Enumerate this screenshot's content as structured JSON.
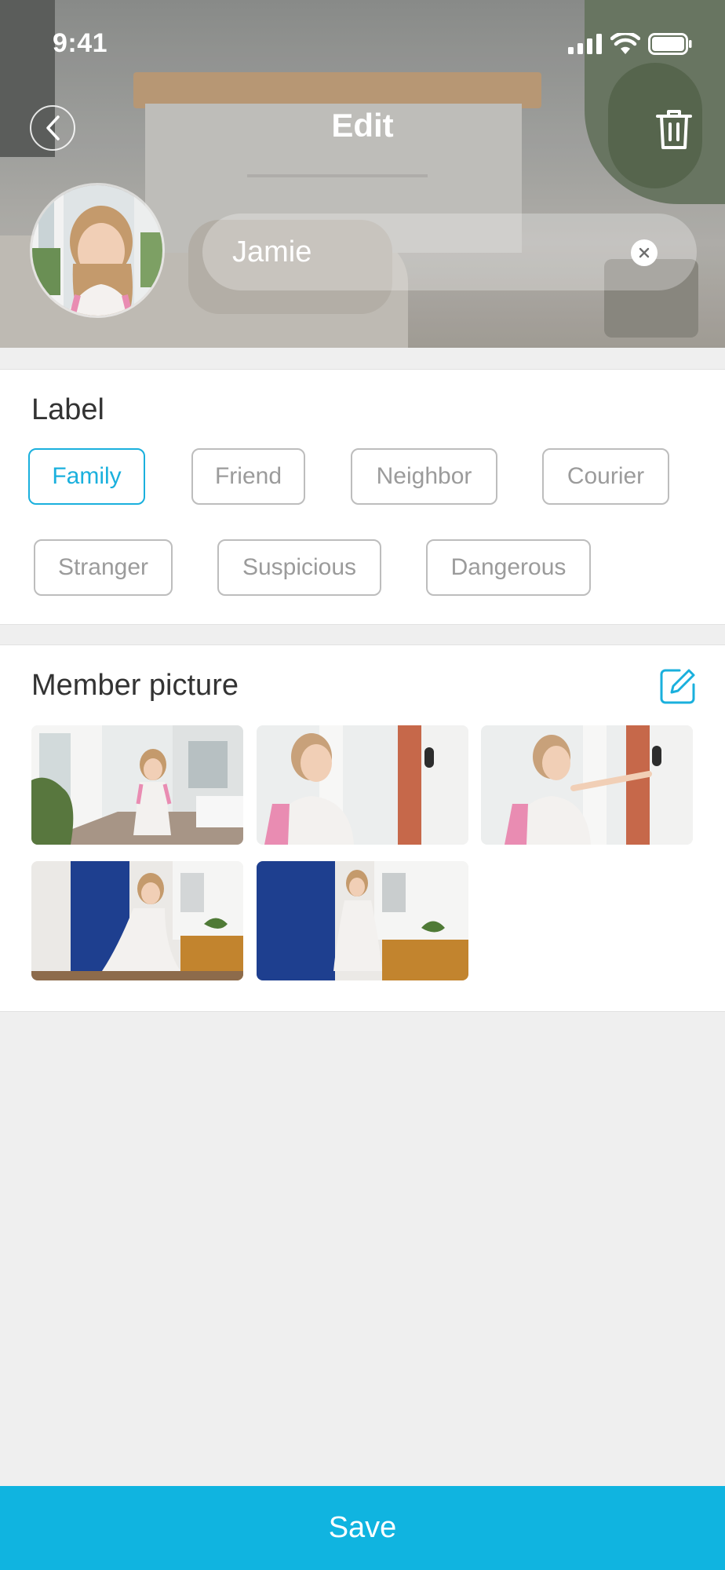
{
  "status_bar": {
    "time": "9:41"
  },
  "header": {
    "title": "Edit",
    "name_value": "Jamie"
  },
  "label_section": {
    "title": "Label",
    "selected": "Family",
    "chips": [
      "Family",
      "Friend",
      "Neighbor",
      "Courier",
      "Stranger",
      "Suspicious",
      "Dangerous"
    ]
  },
  "picture_section": {
    "title": "Member picture",
    "picture_count": 5
  },
  "footer": {
    "save_label": "Save"
  },
  "colors": {
    "accent": "#1ab0dd",
    "save_bar": "#10b4e0",
    "chip_border": "#bdbdbd",
    "chip_text": "#9b9b9b",
    "background": "#efefef"
  },
  "icons": {
    "back": "chevron-left-icon",
    "delete": "trash-icon",
    "clear": "close-circle-icon",
    "edit": "edit-pencil-icon"
  }
}
